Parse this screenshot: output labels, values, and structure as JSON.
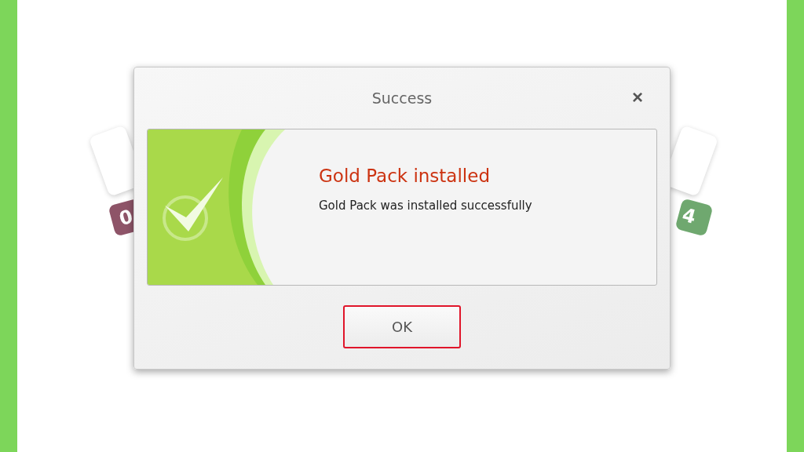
{
  "background_cards": [
    {
      "badge": "0",
      "color": "#8e5468"
    },
    {
      "badge": "4",
      "color": "#6fa86f"
    }
  ],
  "dialog": {
    "title": "Success",
    "close": "×",
    "heading": "Gold Pack installed",
    "message": "Gold Pack was installed successfully",
    "buttons": [
      {
        "label": "OK",
        "focused": true
      }
    ]
  }
}
